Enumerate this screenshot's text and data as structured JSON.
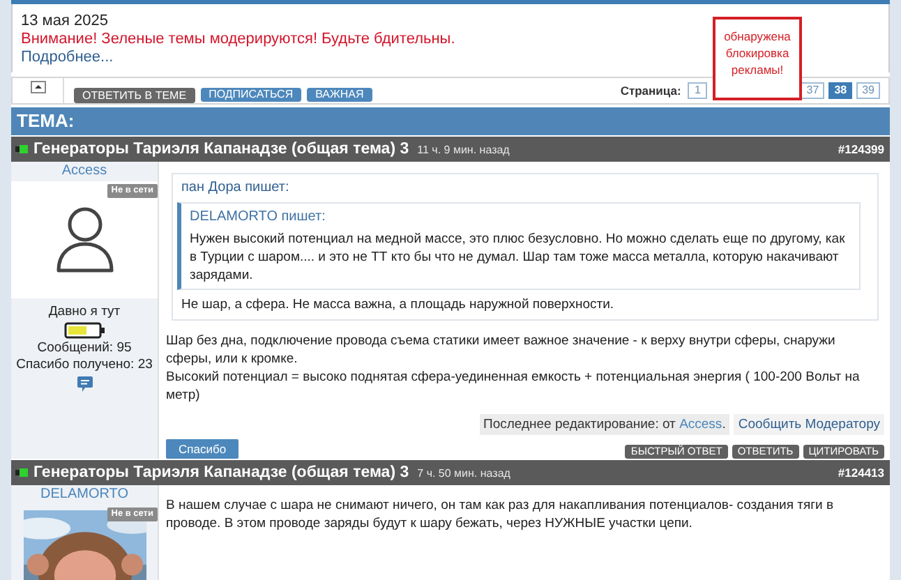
{
  "notice": {
    "date": "13 мая 2025",
    "warning": "Внимание! Зеленые темы модерируются! Будьте бдительны.",
    "more_link": "Подробнее..."
  },
  "toolbar": {
    "buttons": [
      {
        "label": "ОТВЕТИТЬ В ТЕМЕ",
        "kind": "dark"
      },
      {
        "label": "ПОДПИСАТЬСЯ",
        "kind": "blue"
      },
      {
        "label": "ВАЖНАЯ",
        "kind": "blue"
      }
    ],
    "pagination": {
      "label": "Страница:",
      "pages": [
        {
          "label": "1",
          "kind": "page",
          "selected": false
        },
        {
          "label": "37",
          "kind": "page",
          "selected": false
        },
        {
          "label": "38",
          "kind": "page",
          "selected": true
        },
        {
          "label": "39",
          "kind": "page",
          "selected": false
        }
      ]
    }
  },
  "adblock_notice": "обнаружена блокировка рекламы!",
  "section_title": "ТЕМА:",
  "posts": [
    {
      "title": "Генераторы Тариэля Капанадзе (общая тема) 3",
      "time": "11 ч. 9 мин. назад",
      "number": "#124399",
      "author": {
        "name": "Access",
        "online": false,
        "status": "Не в сети",
        "avatar": {
          "kind": "icon"
        },
        "rank": "Давно я тут",
        "messages": "Сообщений: 95",
        "thanks": "Спасибо получено: 23"
      },
      "quote": {
        "header": "пан Дора пишет:",
        "quote": {
          "header": "DELAMORTO пишет:",
          "text": "Нужен высокий потенциал на медной массе, это плюс безусловно. Но можно сделать еще по другому, как в Турции с шаром.... и это не ТТ кто бы что не думал. Шар там тоже масса металла, которую накачивают зарядами."
        },
        "text": "Не шар, а сфера. Не масса важна, а площадь наружной поверхности."
      },
      "paragraphs": [
        "Шар без дна, подключение провода съема статики имеет важное значение - к верху внутри сферы, снаружи сферы, или к кромке.",
        "Высокий потенциал = высоко поднятая сфера-уединенная емкость + потенциальная энергия ( 100-200 Вольт на метр)"
      ],
      "edit_note": {
        "prefix": "Последнее редактирование: от ",
        "author": "Access",
        "suffix": "."
      },
      "report": "Сообщить Модератору",
      "thanks_button": "Спасибо",
      "actions": [
        "БЫСТРЫЙ ОТВЕТ",
        "ОТВЕТИТЬ",
        "ЦИТИРОВАТЬ"
      ]
    },
    {
      "title": "Генераторы Тариэля Капанадзе (общая тема) 3",
      "time": "7 ч. 50 мин. назад",
      "number": "#124413",
      "author": {
        "name": "DELAMORTO",
        "online": false,
        "status": "Не в сети"
      },
      "paragraphs": [
        "В нашем случае с шара не снимают ничего, он там как раз для накапливания потенциалов- создания тяги в проводе. В этом проводе заряды будут к шару бежать, через НУЖНЫЕ участки цепи."
      ]
    }
  ]
}
